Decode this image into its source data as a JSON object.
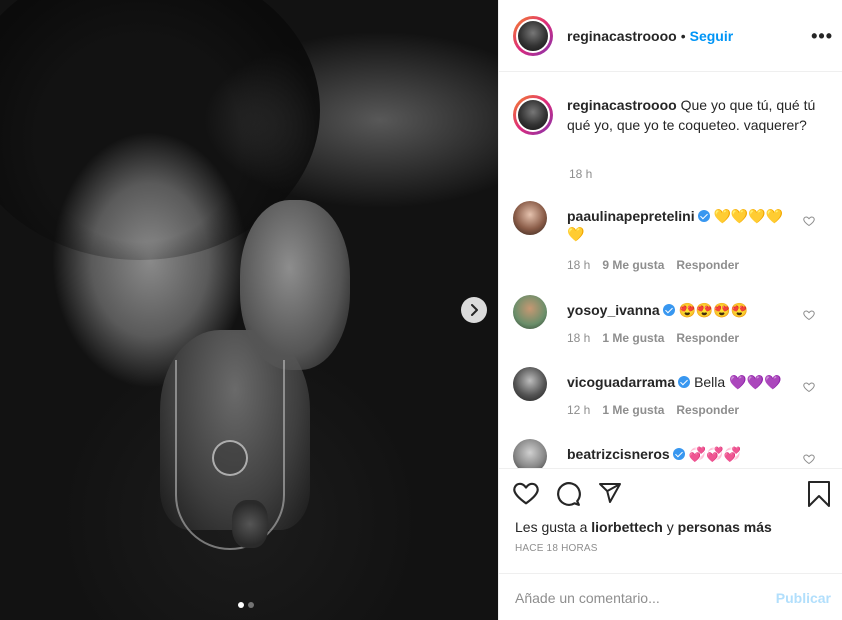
{
  "post": {
    "username": "reginacastroooo",
    "separator": "•",
    "follow_label": "Seguir",
    "more_label": "•••",
    "caption_text": "Que yo que tú, qué tú qué yo, que yo te coqueteo. vaquerer?",
    "caption_time": "18 h",
    "carousel_index": 1,
    "carousel_total": 2
  },
  "comments": [
    {
      "username": "paaulinapepretelini",
      "verified": true,
      "text": "💛💛💛💛💛",
      "time": "18 h",
      "likes": "9 Me gusta",
      "reply": "Responder"
    },
    {
      "username": "yosoy_ivanna",
      "verified": true,
      "text": "😍😍😍😍",
      "time": "18 h",
      "likes": "1 Me gusta",
      "reply": "Responder"
    },
    {
      "username": "vicoguadarrama",
      "verified": true,
      "text": "Bella",
      "emoji": "💜💜💜",
      "time": "12 h",
      "likes": "1 Me gusta",
      "reply": "Responder"
    },
    {
      "username": "beatrizcisneros",
      "verified": true,
      "text": "💞💞💞",
      "time": "",
      "likes": "",
      "reply": ""
    }
  ],
  "likes": {
    "prefix": "Les gusta a",
    "user": "liorbettech",
    "connector": "y",
    "suffix": "personas más"
  },
  "time_ago": "HACE 18 HORAS",
  "add_comment": {
    "placeholder": "Añade un comentario...",
    "publish_label": "Publicar"
  },
  "colors": {
    "link_blue": "#0095f6",
    "publish_disabled": "#b2dffc",
    "verified": "#3897f0",
    "border": "#efefef"
  },
  "icons": [
    "heart-icon",
    "comment-icon",
    "share-icon",
    "bookmark-icon",
    "next-arrow-icon"
  ]
}
